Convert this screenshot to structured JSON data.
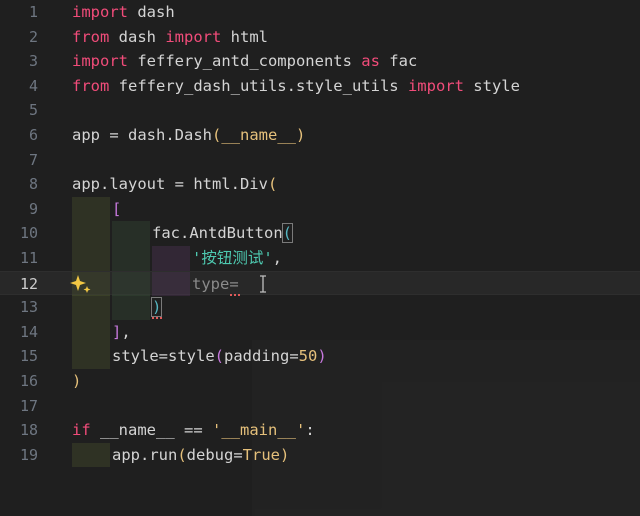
{
  "editor": {
    "current_line": 12,
    "lines": [
      {
        "n": "1"
      },
      {
        "n": "2"
      },
      {
        "n": "3"
      },
      {
        "n": "4"
      },
      {
        "n": "5"
      },
      {
        "n": "6"
      },
      {
        "n": "7"
      },
      {
        "n": "8"
      },
      {
        "n": "9"
      },
      {
        "n": "10"
      },
      {
        "n": "11"
      },
      {
        "n": "12"
      },
      {
        "n": "13"
      },
      {
        "n": "14"
      },
      {
        "n": "15"
      },
      {
        "n": "16"
      },
      {
        "n": "17"
      },
      {
        "n": "18"
      },
      {
        "n": "19"
      }
    ],
    "tokens": {
      "l1": {
        "kw": "import",
        "rest": " dash"
      },
      "l2": {
        "kw1": "from",
        "mid": " dash ",
        "kw2": "import",
        "rest": " html"
      },
      "l3": {
        "kw1": "import",
        "mid": " feffery_antd_components ",
        "kw2": "as",
        "rest": " fac"
      },
      "l4": {
        "kw1": "from",
        "mid": " feffery_dash_utils.style_utils ",
        "kw2": "import",
        "rest": " style"
      },
      "l6": {
        "pre": "app = dash.Dash",
        "open": "(",
        "arg": "__name__",
        "close": ")"
      },
      "l8": {
        "pre": "app.layout = html.Div",
        "open": "("
      },
      "l9": {
        "open": "["
      },
      "l10": {
        "pre": "fac.AntdButton",
        "open": "("
      },
      "l11": {
        "str": "'按钮测试'",
        "rest": ","
      },
      "l12": {
        "text": "type="
      },
      "l13": {
        "close": ")"
      },
      "l14": {
        "close": "]",
        "rest": ","
      },
      "l15": {
        "pre": "style=style",
        "open": "(",
        "arg": "padding=",
        "num": "50",
        "close": ")"
      },
      "l16": {
        "close": ")"
      },
      "l18": {
        "kw": "if",
        "pre": " __name__ == ",
        "str": "'__main__'",
        "rest": ":"
      },
      "l19": {
        "pre": "app.run",
        "open": "(",
        "arg": "debug=",
        "val": "True",
        "close": ")"
      }
    }
  },
  "colors": {
    "background": "#1f1f1f",
    "keyword": "#f14c7a",
    "string": "#e5c07b",
    "cjk_string": "#4ec9b0",
    "line_number": "#6e7681",
    "sparkle": "#f2c744"
  },
  "icons": {
    "gutter": "sparkle-icon",
    "pointer": "text-cursor-icon"
  }
}
